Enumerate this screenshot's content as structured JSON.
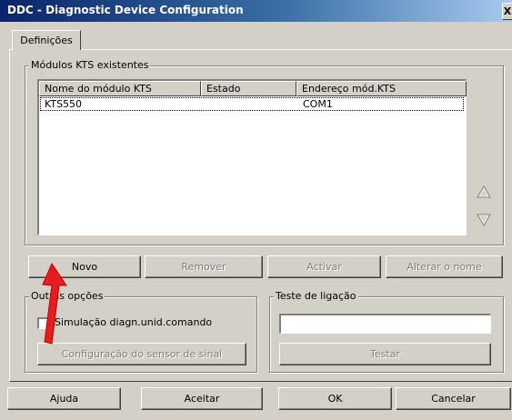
{
  "window": {
    "title": "DDC - Diagnostic Device Configuration",
    "close_glyph": "X"
  },
  "tabs": [
    {
      "label": "Definições"
    }
  ],
  "modules": {
    "group_title": "Módulos KTS existentes",
    "columns": [
      "Nome do módulo KTS",
      "Estado",
      "Endereço mód.KTS"
    ],
    "rows": [
      {
        "name": "KTS550",
        "state": "",
        "address": "COM1"
      }
    ],
    "up_icon": "triangle-up-outline",
    "down_icon": "triangle-down-outline"
  },
  "module_buttons": {
    "new": "Novo",
    "remove": "Remover",
    "activate": "Activar",
    "rename": "Alterar o nome"
  },
  "other_options": {
    "group_title": "Outras opções",
    "simulation_checkbox_label": "Simulação diagn.unid.comando",
    "simulation_checked": false,
    "signal_sensor_button": "Configuração do sensor de sinal"
  },
  "connection_test": {
    "group_title": "Teste de ligação",
    "input_value": "",
    "test_button": "Testar"
  },
  "footer_buttons": {
    "help": "Ajuda",
    "accept": "Aceitar",
    "ok": "OK",
    "cancel": "Cancelar"
  },
  "colors": {
    "titlebar_start": "#0a246a",
    "titlebar_end": "#a6caf0",
    "face": "#d4d0c8",
    "pointer": "#e41e1e"
  }
}
